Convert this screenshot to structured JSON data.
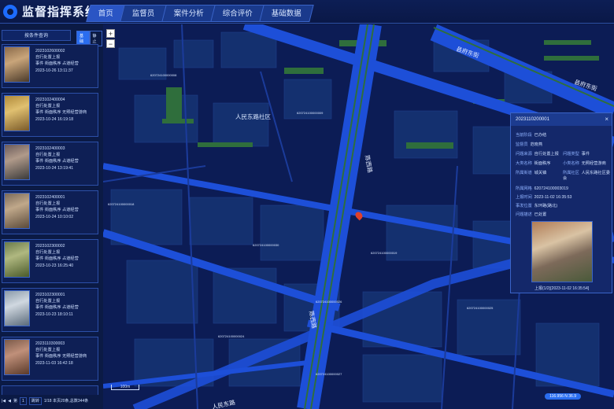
{
  "app": {
    "title": "监督指挥系统"
  },
  "nav": {
    "tabs": [
      "首页",
      "监督员",
      "案件分析",
      "综合评价",
      "基础数据"
    ]
  },
  "sidebar": {
    "search_label": "按条件查询",
    "toggle": [
      "基础",
      "静止"
    ],
    "cases": [
      {
        "id": "2023102600002",
        "type": "自行处置上报",
        "line3": "事件  街面秩序  占道经营",
        "time": "2023-10-26 13:11:37"
      },
      {
        "id": "2023102400004",
        "type": "自行处置上报",
        "line3": "事件  街面秩序  无照经营游商",
        "time": "2023-10-24 16:19:18"
      },
      {
        "id": "2023102400003",
        "type": "自行处置上报",
        "line3": "事件  街面秩序  占道经营",
        "time": "2023-10-24 13:19:41"
      },
      {
        "id": "2023102400001",
        "type": "自行处置上报",
        "line3": "事件  街面秩序  占道经营",
        "time": "2023-10-24 10:10:02"
      },
      {
        "id": "2023102300002",
        "type": "自行处置上报",
        "line3": "事件  街面秩序  占道经营",
        "time": "2023-10-23 16:25:40"
      },
      {
        "id": "2023102300001",
        "type": "自行处置上报",
        "line3": "事件  街面秩序  占道经营",
        "time": "2023-10-23 18:10:11"
      },
      {
        "id": "2023110300003",
        "type": "自行处置上报",
        "line3": "事件  街面秩序  无照经营游商",
        "time": "2023-11-03 16:42:18"
      }
    ],
    "pager": {
      "page": "1",
      "go": "跳转",
      "info": "1/18 本页20条,总数344条"
    }
  },
  "map": {
    "labels": [
      "县府东街",
      "县府东街",
      "人民东路社区",
      "人民东路",
      "陈西路",
      "陈西路",
      "620724100000009",
      "620724100000018",
      "620724100000030",
      "620724100000019",
      "620724100000024",
      "620724100000025",
      "620724100000026",
      "620724100000027",
      "620724100000008"
    ],
    "scale": "100m",
    "badge": "116.956 N 36.9"
  },
  "popup": {
    "title": "2023110200001",
    "close": "×",
    "rows": [
      [
        "当前阶段",
        "已办结"
      ],
      [
        "监督员",
        "范晓燕"
      ],
      [
        "问题来源",
        "自行处置上报",
        "问题类型",
        "事件"
      ],
      [
        "大类名称",
        "街面秩序",
        "小类名称",
        "无照经营游商"
      ],
      [
        "所属街道",
        "城关镇",
        "所属社区",
        "人民东路社区委会"
      ],
      [
        "所属网格",
        "620724100003019"
      ],
      [
        "上报时间",
        "2023-11-02 16:35:53"
      ],
      [
        "事发位置",
        "东环路(路北)"
      ],
      [
        "问题描述",
        "已处置"
      ]
    ],
    "caption": "上报(1/2)[2023-11-02 16:35:54]"
  },
  "colors": {
    "accent": "#2a6df0",
    "road": "#1d4fd8",
    "greenbelt": "#2f6e3c",
    "building": "#14306f"
  }
}
